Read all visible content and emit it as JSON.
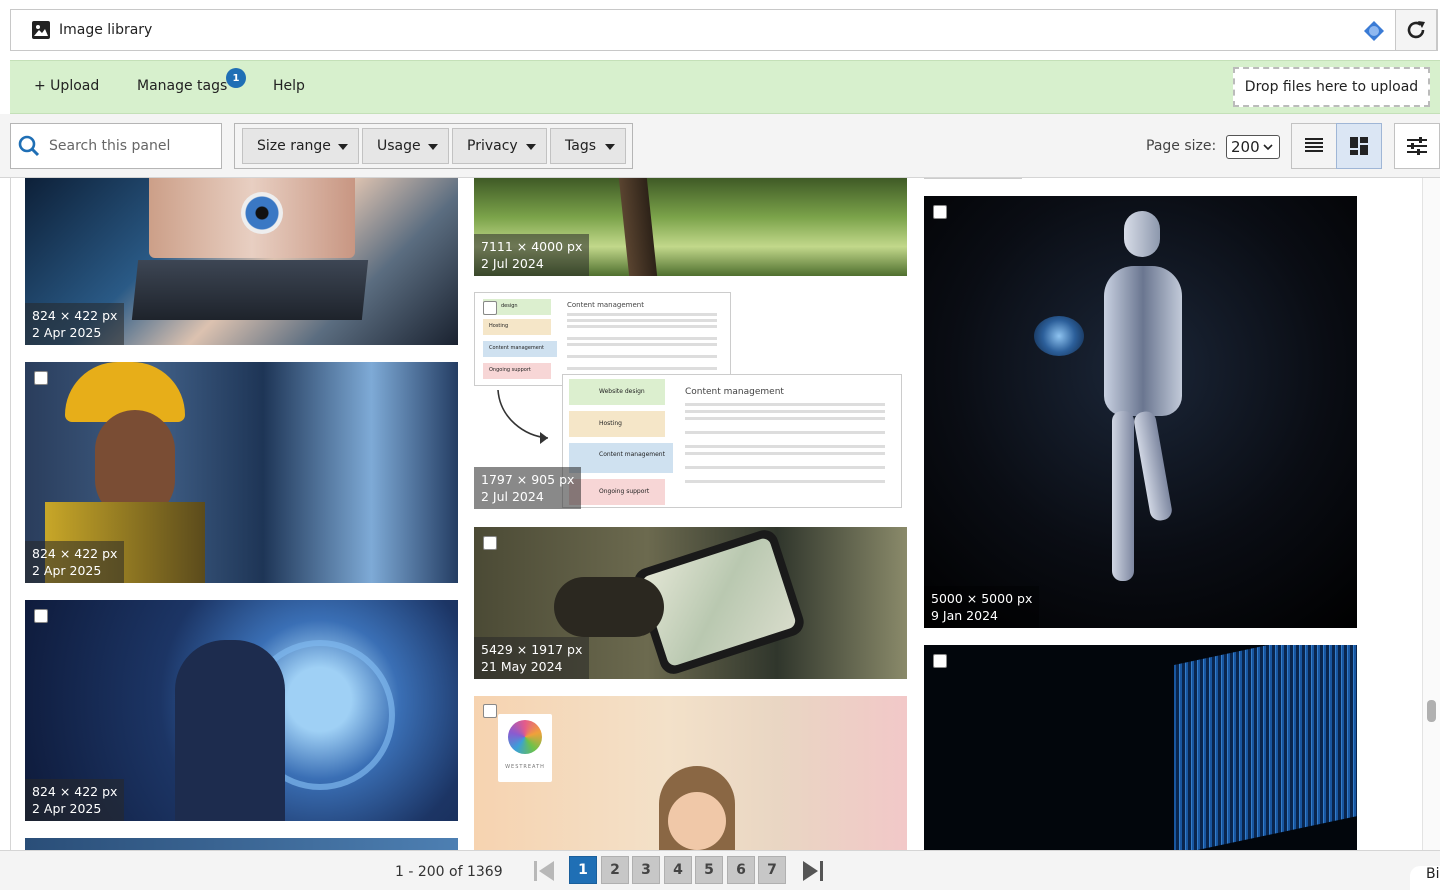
{
  "window": {
    "title": "Image library"
  },
  "actions": {
    "upload": "+ Upload",
    "manage_tags": "Manage tags",
    "manage_tags_count": "1",
    "help": "Help",
    "drop_zone": "Drop files here to upload"
  },
  "filters": {
    "search_placeholder": "Search this panel",
    "buttons": [
      "Size range",
      "Usage",
      "Privacy",
      "Tags"
    ],
    "page_size_label": "Page size:",
    "page_size_value": "200"
  },
  "images": [
    {
      "size": "824 × 422 px",
      "date": "2 Apr 2025",
      "subject": "eye and laptop"
    },
    {
      "size": "824 × 422 px",
      "date": "2 Apr 2025",
      "subject": "engineer in hard hat"
    },
    {
      "size": "824 × 422 px",
      "date": "2 Apr 2025",
      "subject": "man touching gear hologram"
    },
    {
      "size": "7111 × 4000 px",
      "date": "2 Jul 2024",
      "subject": "forest plants"
    },
    {
      "size": "1797 × 905 px",
      "date": "2 Jul 2024",
      "subject": "content management screenshot"
    },
    {
      "size": "5429 × 1917 px",
      "date": "21 May 2024",
      "subject": "hand holding phone map"
    },
    {
      "size": "",
      "date": "",
      "subject": "child with logo"
    },
    {
      "size": "5000 × 5000 px",
      "date": "9 Jan 2024",
      "subject": "robot holding brain"
    },
    {
      "size": "",
      "date": "",
      "subject": "blue light wall"
    }
  ],
  "screenshot": {
    "heading": "Content management",
    "left_items": [
      "design",
      "Hosting",
      "Content management",
      "Ongoing support"
    ],
    "right_items": [
      "Website design",
      "Hosting",
      "Content management",
      "Ongoing support"
    ],
    "logo_text": "WESTREATH"
  },
  "pagination": {
    "summary": "1 - 200 of 1369",
    "pages": [
      "1",
      "2",
      "3",
      "4",
      "5",
      "6",
      "7"
    ],
    "current": "1",
    "corner_text": "Bi"
  }
}
